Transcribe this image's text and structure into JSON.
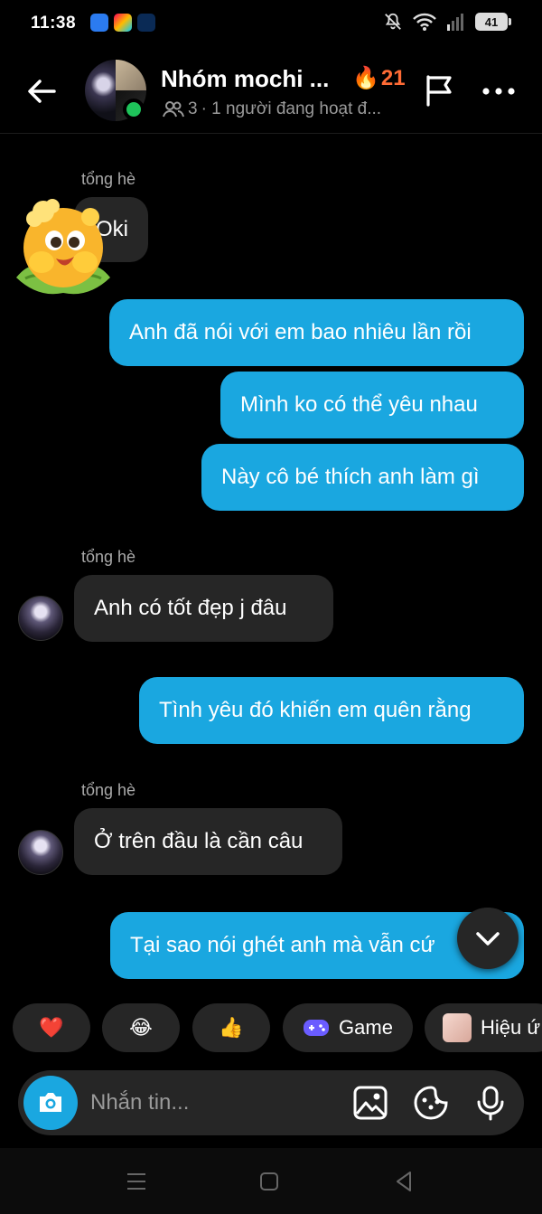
{
  "status_bar": {
    "time": "11:38",
    "battery": "41"
  },
  "header": {
    "title": "Nhóm mochi ...",
    "streak": "21",
    "member_count": "3",
    "active_text": "· 1 người đang hoạt đ..."
  },
  "messages": [
    {
      "sender": "tổng hè",
      "text": "Oki"
    },
    {
      "text": "Anh đã nói với em bao nhiêu lần rồi"
    },
    {
      "text": "Mình ko có thể yêu nhau"
    },
    {
      "text": "Này cô bé thích anh làm gì"
    },
    {
      "sender": "tổng hè",
      "text": "Anh có tốt đẹp j đâu"
    },
    {
      "text": "Tình yêu đó khiến em quên rằng"
    },
    {
      "sender": "tổng hè",
      "text": "Ở trên đầu là cần câu"
    },
    {
      "text": "Tại sao nói ghét anh mà vẫn cứ"
    }
  ],
  "quick_replies": {
    "heart": "❤️",
    "laugh": "😂",
    "thumbs": "👍",
    "game": "Game",
    "effects": "Hiệu ứ"
  },
  "composer": {
    "placeholder": "Nhắn tin..."
  },
  "colors": {
    "outgoing_bubble": "#1aa7e0",
    "incoming_bubble": "#262626",
    "background": "#000000",
    "streak": "#ff6b35",
    "online": "#1ec35a"
  }
}
